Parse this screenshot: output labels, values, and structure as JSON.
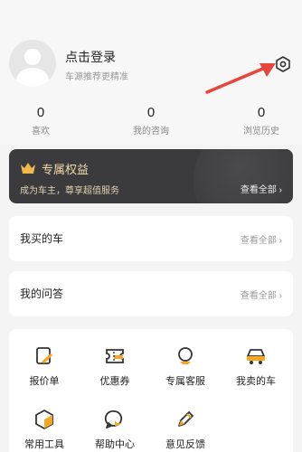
{
  "profile": {
    "login_title": "点击登录",
    "login_subtitle": "车源推荐更精准"
  },
  "stats": [
    {
      "value": "0",
      "label": "喜欢"
    },
    {
      "value": "0",
      "label": "我的咨询"
    },
    {
      "value": "0",
      "label": "浏览历史"
    }
  ],
  "vip": {
    "title": "专属权益",
    "subtitle": "成为车主，尊享超值服务",
    "link": "查看全部 ›"
  },
  "sections": [
    {
      "title": "我买的车",
      "link": "查看全部 ›"
    },
    {
      "title": "我的问答",
      "link": "查看全部 ›"
    }
  ],
  "tools": [
    {
      "label": "报价单",
      "icon": "quote-sheet-icon"
    },
    {
      "label": "优惠券",
      "icon": "coupon-icon"
    },
    {
      "label": "专属客服",
      "icon": "customer-service-icon"
    },
    {
      "label": "我卖的车",
      "icon": "sold-car-icon"
    },
    {
      "label": "常用工具",
      "icon": "tools-cube-icon"
    },
    {
      "label": "帮助中心",
      "icon": "help-chat-icon"
    },
    {
      "label": "意见反馈",
      "icon": "feedback-pen-icon"
    }
  ],
  "colors": {
    "accent": "#f5a623",
    "annotation_arrow": "#e8453c",
    "vip_background": "#3b3b3d",
    "vip_gold": "#f1d9a8"
  }
}
